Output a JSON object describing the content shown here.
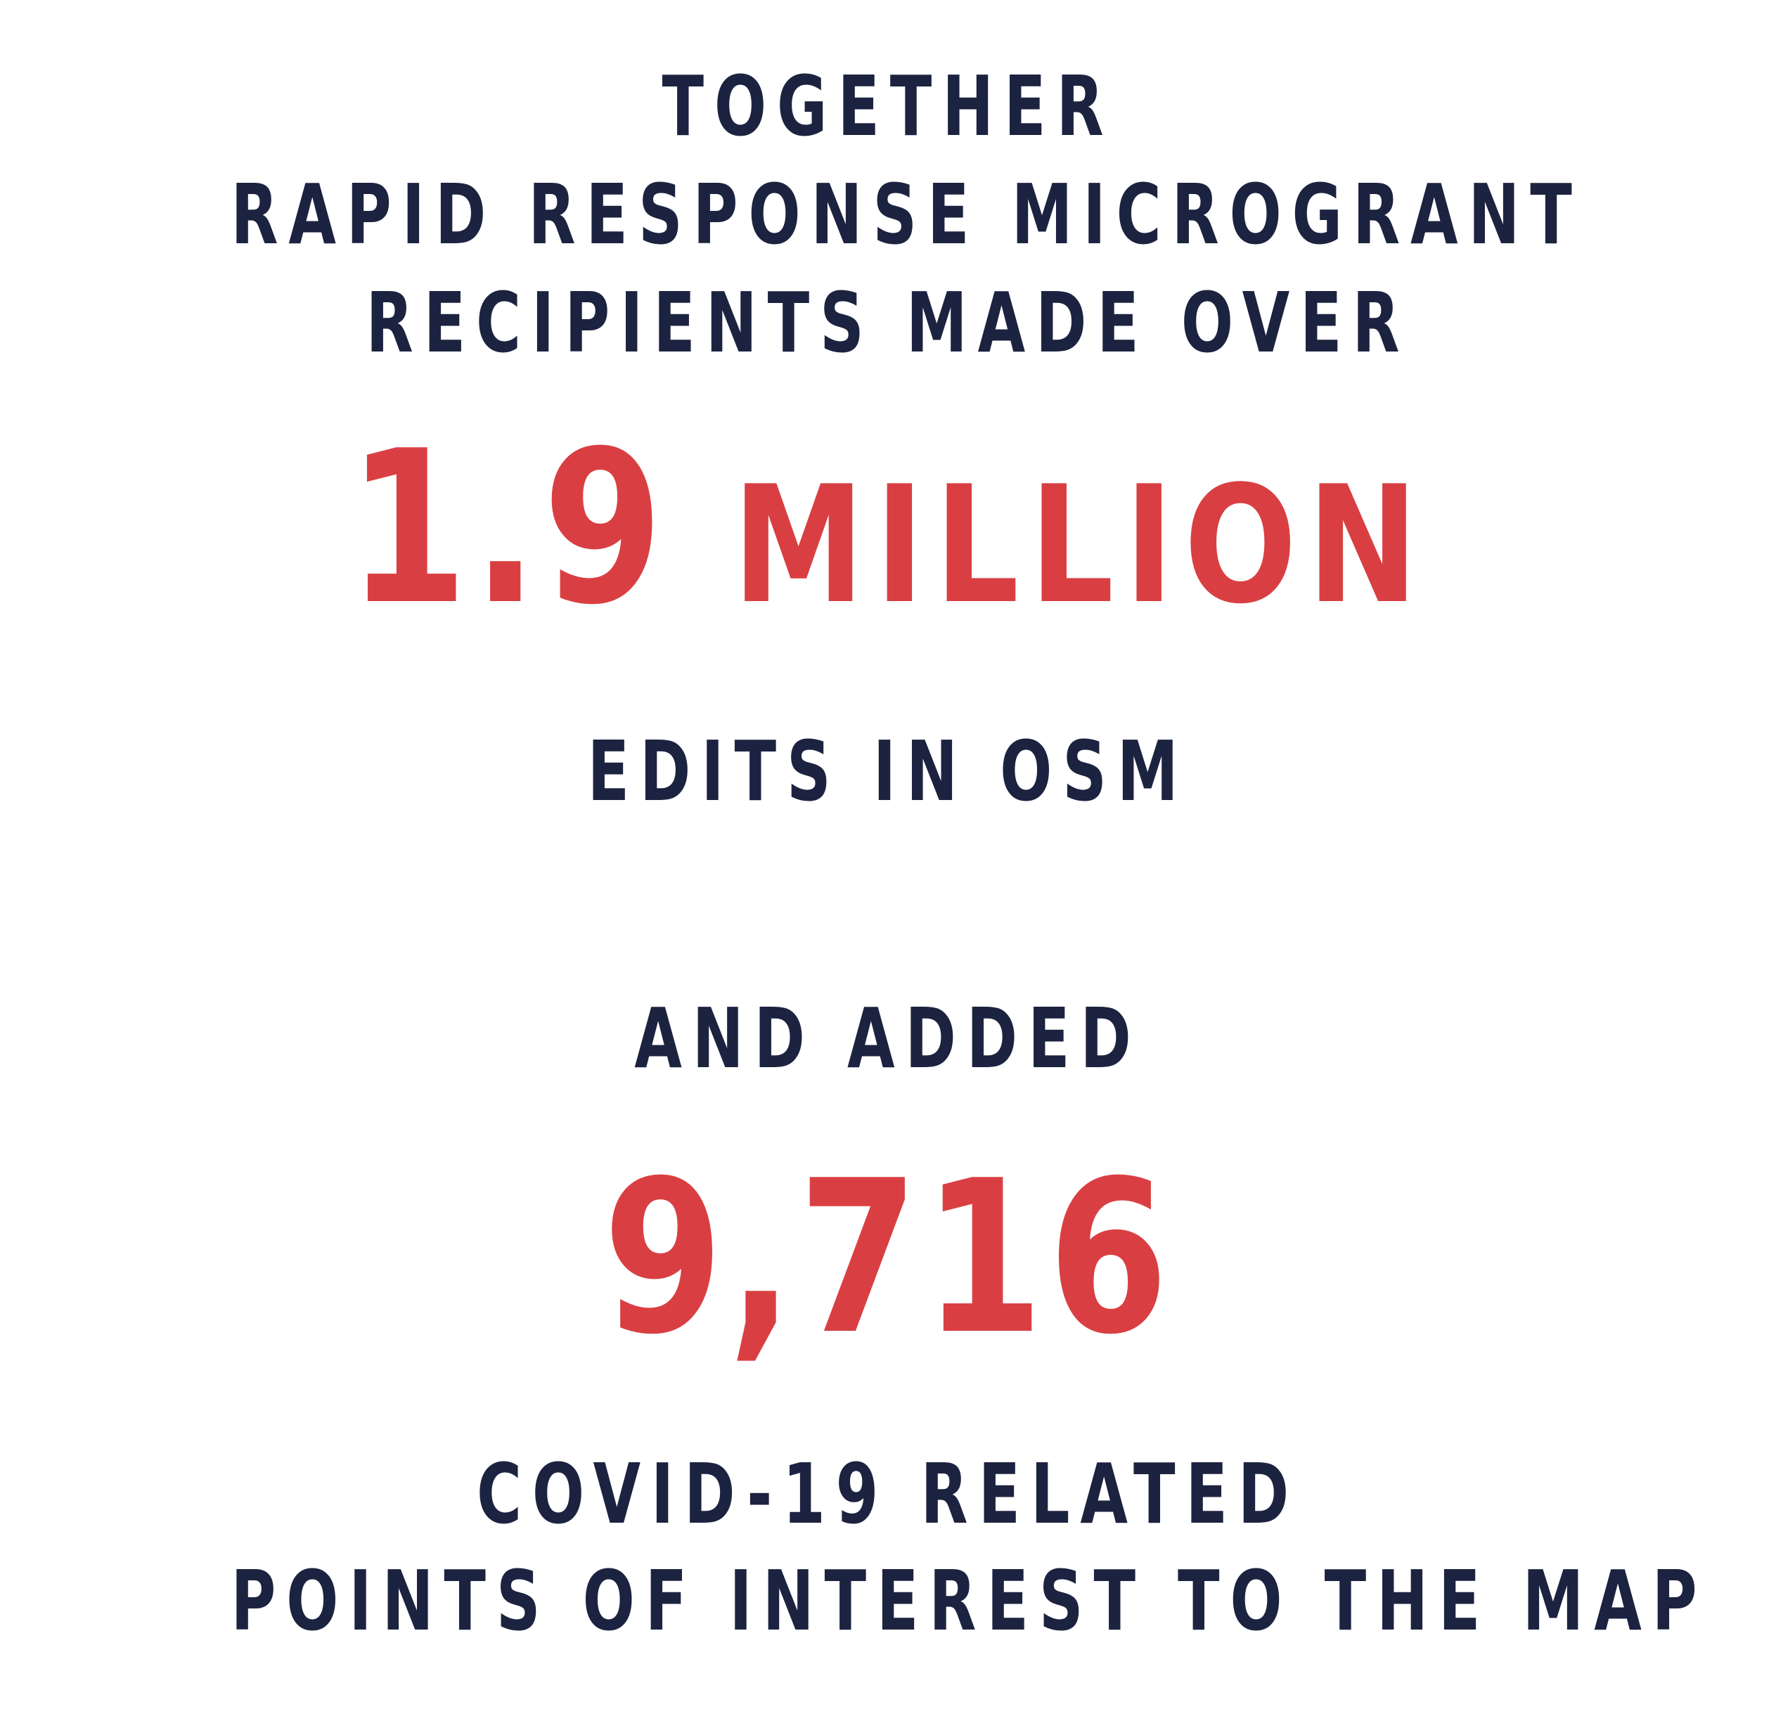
{
  "intro": {
    "line1": "TOGETHER",
    "line2": "RAPID RESPONSE MICROGRANT",
    "line3": "RECIPIENTS MADE OVER"
  },
  "stat1": {
    "number": "1.9",
    "unit": "MILLION",
    "caption": "EDITS IN OSM"
  },
  "connector": "AND ADDED",
  "stat2": {
    "number": "9,716",
    "caption_line1": "COVID-19 RELATED",
    "caption_line2": "POINTS OF INTEREST TO THE MAP"
  },
  "colors": {
    "text_dark": "#1c2340",
    "accent_red": "#d93f42",
    "background": "#ffffff"
  }
}
